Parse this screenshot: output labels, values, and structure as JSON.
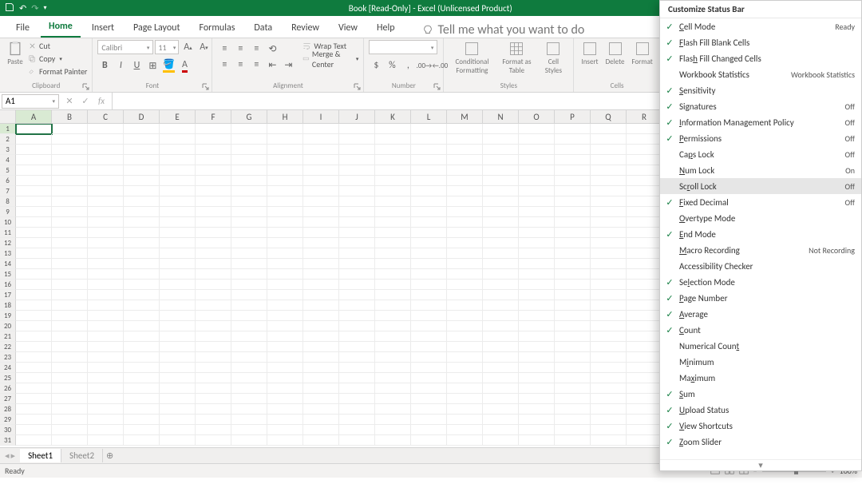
{
  "title": "Book  [Read-Only]  -  Excel (Unlicensed Product)",
  "tabs": [
    "File",
    "Home",
    "Insert",
    "Page Layout",
    "Formulas",
    "Data",
    "Review",
    "View",
    "Help"
  ],
  "active_tab": 1,
  "tellme": "Tell me what you want to do",
  "clipboard": {
    "paste": "Paste",
    "cut": "Cut",
    "copy": "Copy",
    "fp": "Format Painter",
    "label": "Clipboard"
  },
  "font": {
    "name": "Calibri",
    "size": "11",
    "label": "Font"
  },
  "alignment": {
    "wrap": "Wrap Text",
    "merge": "Merge & Center",
    "label": "Alignment"
  },
  "number": {
    "label": "Number"
  },
  "styles": {
    "cf": "Conditional Formatting",
    "fat": "Format as Table",
    "cs": "Cell Styles",
    "label": "Styles"
  },
  "cells": {
    "ins": "Insert",
    "del": "Delete",
    "fmt": "Format",
    "label": "Cells"
  },
  "cellref": "A1",
  "cols": [
    "A",
    "B",
    "C",
    "D",
    "E",
    "F",
    "G",
    "H",
    "I",
    "J",
    "K",
    "L",
    "M",
    "N",
    "O",
    "P",
    "Q",
    "R"
  ],
  "rows": 31,
  "sheets": [
    "Sheet1",
    "Sheet2"
  ],
  "active_sheet": 0,
  "status": "Ready",
  "zoom": "100%",
  "ctx": {
    "title": "Customize Status Bar",
    "items": [
      {
        "chk": true,
        "label": "Cell Mode",
        "ukey": "C",
        "status": "Ready"
      },
      {
        "chk": true,
        "label": "Flash Fill Blank Cells",
        "ukey": "F"
      },
      {
        "chk": true,
        "label": "Flash Fill Changed Cells",
        "u": "F",
        "html": "Flas<span class='u'>h</span> Fill Changed Cells"
      },
      {
        "chk": false,
        "label": "Workbook Statistics",
        "status": "Workbook Statistics"
      },
      {
        "chk": true,
        "label": "Sensitivity",
        "ukey": "S"
      },
      {
        "chk": true,
        "label": "Signatures",
        "html": "Si<span class='u'>g</span>natures",
        "status": "Off"
      },
      {
        "chk": true,
        "label": "Information Management Policy",
        "ukey": "I",
        "status": "Off"
      },
      {
        "chk": true,
        "label": "Permissions",
        "ukey": "P",
        "status": "Off"
      },
      {
        "chk": false,
        "label": "Caps Lock",
        "html": "Ca<span class='u'>p</span>s Lock",
        "status": "Off"
      },
      {
        "chk": false,
        "label": "Num Lock",
        "ukey": "N",
        "status": "On"
      },
      {
        "chk": false,
        "label": "Scroll Lock",
        "html": "Sc<span class='u'>r</span>oll Lock",
        "status": "Off",
        "hov": true
      },
      {
        "chk": true,
        "label": "Fixed Decimal",
        "ukey": "F",
        "status": "Off"
      },
      {
        "chk": false,
        "label": "Overtype Mode",
        "ukey": "O"
      },
      {
        "chk": true,
        "label": "End Mode",
        "ukey": "E"
      },
      {
        "chk": false,
        "label": "Macro Recording",
        "html": "<span class='u'>M</span>acro Recording",
        "status": "Not Recording"
      },
      {
        "chk": false,
        "label": "Accessibility Checker"
      },
      {
        "chk": true,
        "label": "Selection Mode",
        "html": "Se<span class='u'>l</span>ection Mode"
      },
      {
        "chk": true,
        "label": "Page Number",
        "ukey": "P"
      },
      {
        "chk": true,
        "label": "Average",
        "ukey": "A"
      },
      {
        "chk": true,
        "label": "Count",
        "ukey": "C"
      },
      {
        "chk": false,
        "label": "Numerical Count",
        "html": "Numerical Coun<span class='u'>t</span>"
      },
      {
        "chk": false,
        "label": "Minimum",
        "html": "M<span class='u'>i</span>nimum"
      },
      {
        "chk": false,
        "label": "Maximum",
        "html": "Ma<span class='u'>x</span>imum"
      },
      {
        "chk": true,
        "label": "Sum",
        "ukey": "S"
      },
      {
        "chk": true,
        "label": "Upload Status",
        "ukey": "U"
      },
      {
        "chk": true,
        "label": "View Shortcuts",
        "ukey": "V"
      },
      {
        "chk": true,
        "label": "Zoom Slider",
        "ukey": "Z"
      }
    ]
  }
}
